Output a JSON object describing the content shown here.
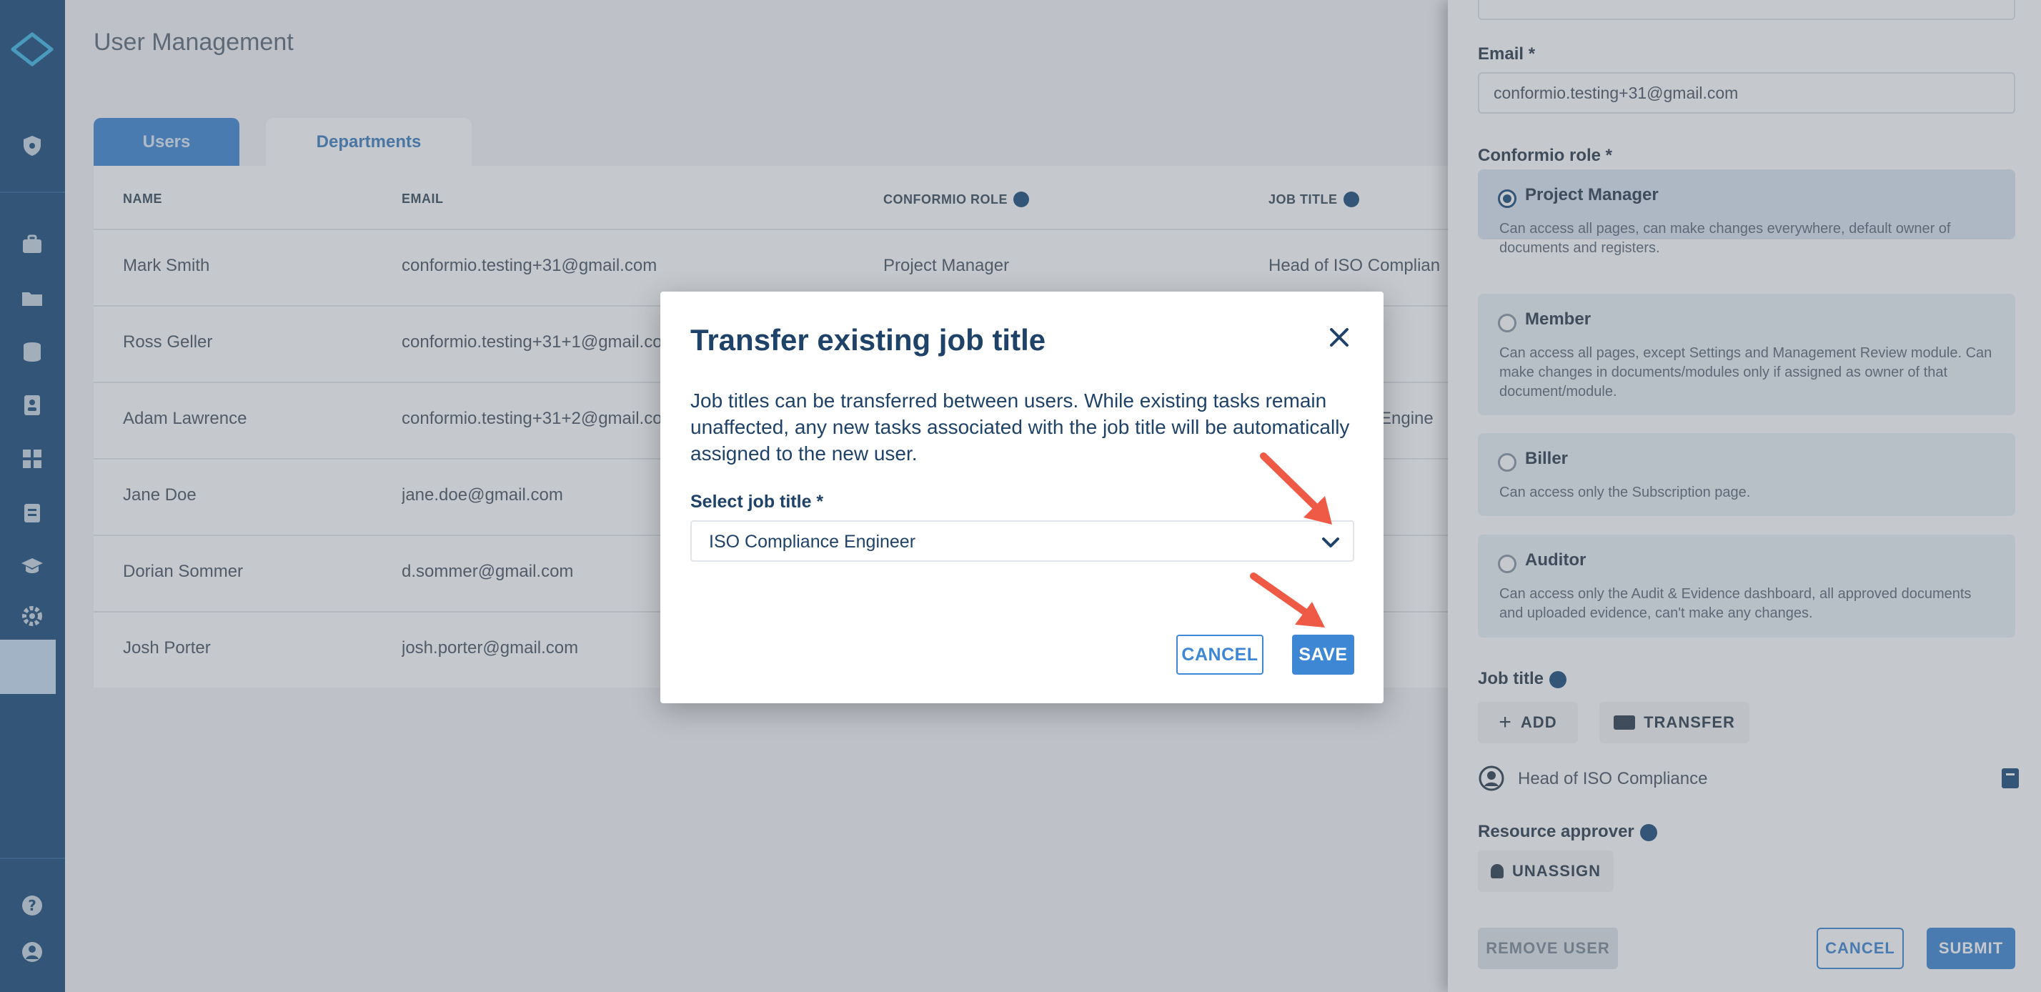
{
  "app": {
    "page_title": "User Management"
  },
  "colors": {
    "brand": "#1c4e7c",
    "accent": "#3d87d4",
    "annotation_arrow": "#ee5a45"
  },
  "sidebar": {
    "icons": [
      "shield-icon",
      "briefcase-icon",
      "folder-icon",
      "database-icon",
      "contact-card-icon",
      "dashboard-icon",
      "clipboard-icon",
      "graduation-cap-icon",
      "gear-icon",
      "help-icon",
      "user-circle-icon"
    ]
  },
  "tabs": [
    {
      "label": "Users",
      "active": true
    },
    {
      "label": "Departments",
      "active": false
    }
  ],
  "table": {
    "headers": {
      "name": "NAME",
      "email": "EMAIL",
      "role": "CONFORMIO ROLE",
      "job_title": "JOB TITLE"
    },
    "rows": [
      {
        "name": "Mark Smith",
        "email": "conformio.testing+31@gmail.com",
        "role": "Project Manager",
        "job_title": "Head of ISO Complian"
      },
      {
        "name": "Ross Geller",
        "email": "conformio.testing+31+1@gmail.co",
        "role": "",
        "job_title": ""
      },
      {
        "name": "Adam Lawrence",
        "email": "conformio.testing+31+2@gmail.co",
        "role": "",
        "job_title": "e Engine"
      },
      {
        "name": "Jane Doe",
        "email": "jane.doe@gmail.com",
        "role": "",
        "job_title": ""
      },
      {
        "name": "Dorian Sommer",
        "email": "d.sommer@gmail.com",
        "role": "",
        "job_title": ""
      },
      {
        "name": "Josh Porter",
        "email": "josh.porter@gmail.com",
        "role": "",
        "job_title": ""
      }
    ]
  },
  "drawer": {
    "email_label": "Email *",
    "email_value": "conformio.testing+31@gmail.com",
    "role_label": "Conformio role *",
    "roles": [
      {
        "name": "Project Manager",
        "desc": "Can access all pages, can make changes everywhere, default owner of documents and registers.",
        "selected": true
      },
      {
        "name": "Member",
        "desc": "Can access all pages, except Settings and Management Review module. Can make changes in documents/modules only if assigned as owner of that document/module.",
        "selected": false
      },
      {
        "name": "Biller",
        "desc": "Can access only the Subscription page.",
        "selected": false
      },
      {
        "name": "Auditor",
        "desc": "Can access only the Audit & Evidence dashboard, all approved documents and uploaded evidence, can't make any changes.",
        "selected": false
      }
    ],
    "job_title_label": "Job title",
    "add_label": "ADD",
    "transfer_label": "TRANSFER",
    "assigned_job_title": "Head of ISO Compliance",
    "resource_approver_label": "Resource approver",
    "unassign_label": "UNASSIGN",
    "remove_user_label": "REMOVE USER",
    "cancel_label": "CANCEL",
    "submit_label": "SUBMIT"
  },
  "modal": {
    "title": "Transfer existing job title",
    "description": "Job titles can be transferred between users. While existing tasks remain unaffected, any new tasks associated with the job title will be automatically assigned to the new user.",
    "select_label": "Select job title *",
    "select_value": "ISO Compliance Engineer",
    "cancel_label": "CANCEL",
    "save_label": "SAVE"
  }
}
